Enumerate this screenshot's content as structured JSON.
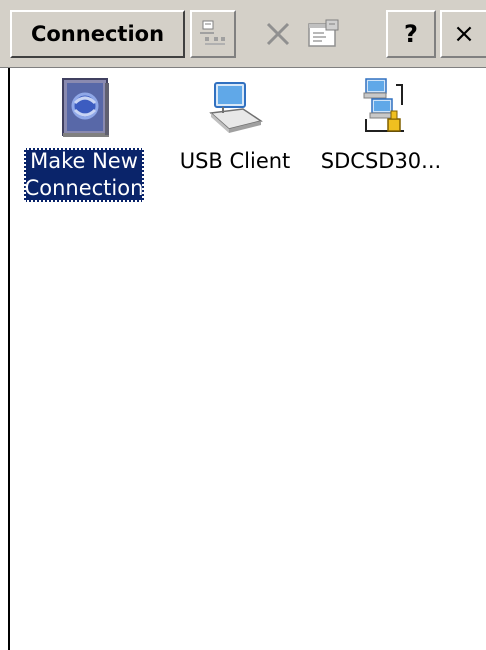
{
  "window": {
    "title": "Connection"
  },
  "toolbar": {
    "buttons": [
      {
        "name": "details-view",
        "icon": "details-view-icon"
      },
      {
        "name": "delete",
        "icon": "delete-x-icon"
      },
      {
        "name": "properties",
        "icon": "properties-icon"
      },
      {
        "name": "help",
        "label": "?"
      },
      {
        "name": "close",
        "label": "×"
      }
    ]
  },
  "items": [
    {
      "label_line1": "Make New",
      "label_line2": "Connection",
      "icon": "make-new-connection-icon",
      "selected": true
    },
    {
      "label": "USB Client",
      "icon": "usb-client-icon",
      "selected": false
    },
    {
      "label": "SDCSD30...",
      "icon": "network-connection-icon",
      "selected": false
    }
  ],
  "colors": {
    "toolbar_bg": "#d4d0c8",
    "selection_bg": "#0a246a",
    "selection_text": "#ffffff"
  }
}
